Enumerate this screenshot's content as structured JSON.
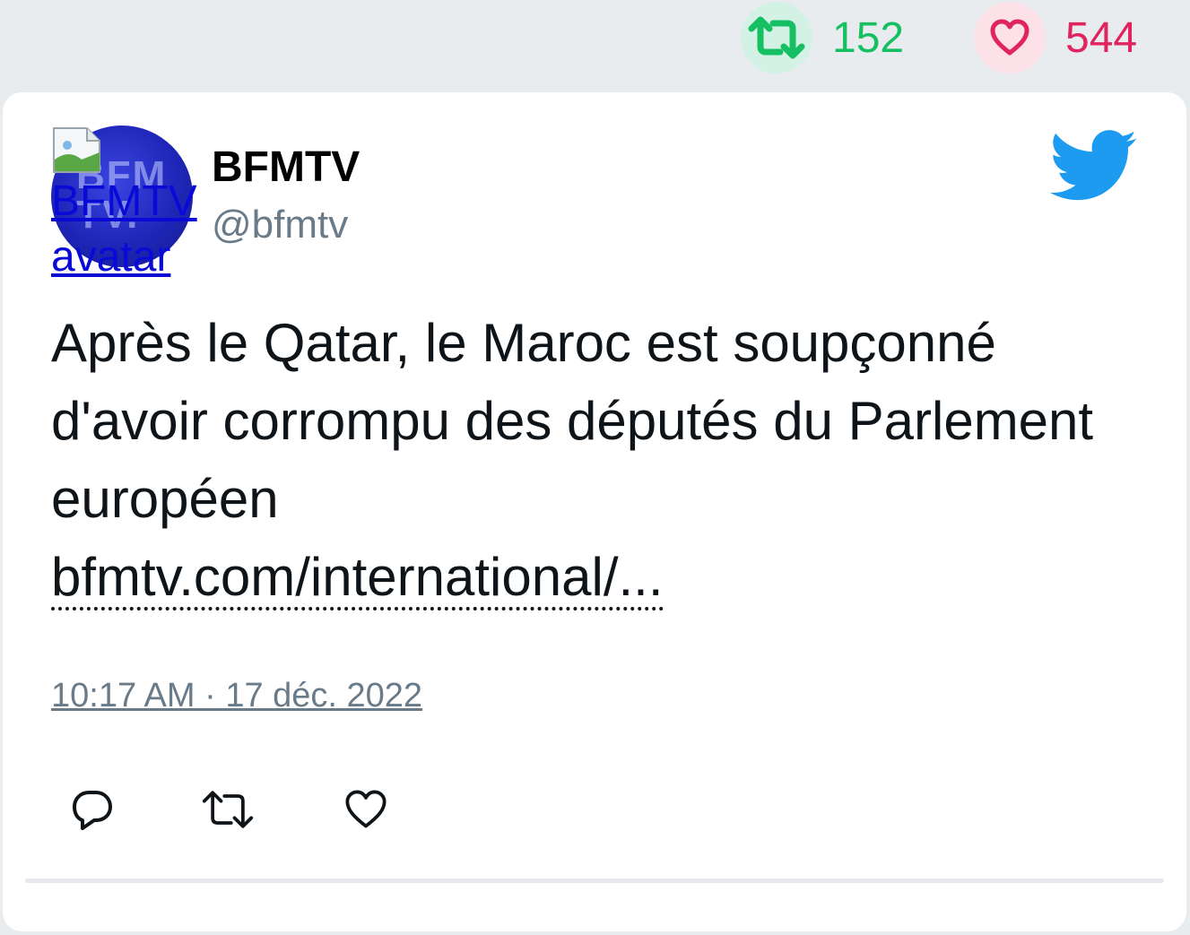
{
  "stats": {
    "retweets": "152",
    "likes": "544",
    "retweet_color": "#17bf63",
    "like_color": "#e0245e",
    "retweet_icon": "retweet-icon",
    "like_icon": "heart-icon"
  },
  "tweet": {
    "avatar_alt": "BFMTV avatar",
    "avatar_lettering": "BFM TV.",
    "display_name": "BFMTV",
    "handle": "@bfmtv",
    "brand_icon": "twitter-bird-icon",
    "text": "Après le Qatar, le Maroc est soupçonné d'avoir corrompu des députés du Parlement européen",
    "link": "bfmtv.com/international/...",
    "timestamp": "10:17 AM · 17 déc. 2022"
  },
  "actions": {
    "reply_icon": "reply-icon",
    "retweet_icon": "retweet-icon",
    "like_icon": "heart-icon"
  },
  "colors": {
    "brand_blue": "#1d9bf0",
    "muted_text": "#697a89"
  }
}
